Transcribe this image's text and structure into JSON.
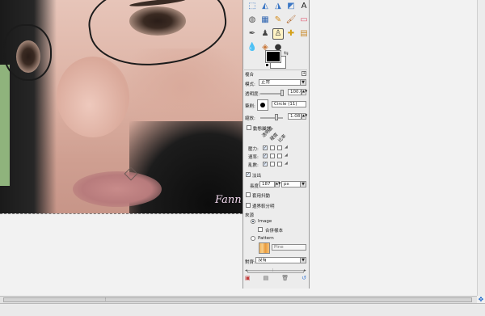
{
  "canvas": {
    "watermark_text": "Fann"
  },
  "toolbox": {
    "tools": [
      {
        "name": "rect-select-icon",
        "glyph": "⬚",
        "color": "#3a76c4"
      },
      {
        "name": "free-select-icon",
        "glyph": "◭",
        "color": "#3a76c4"
      },
      {
        "name": "fuzzy-select-icon",
        "glyph": "◮",
        "color": "#3a76c4"
      },
      {
        "name": "crop-icon",
        "glyph": "◩",
        "color": "#3a76c4"
      },
      {
        "name": "text-icon",
        "glyph": "A",
        "color": "#222222"
      },
      {
        "name": "bucket-fill-icon",
        "glyph": "◍",
        "color": "#555555"
      },
      {
        "name": "gradient-icon",
        "glyph": "▦",
        "color": "#2e64b0"
      },
      {
        "name": "pencil-icon",
        "glyph": "✎",
        "color": "#d48a17"
      },
      {
        "name": "paintbrush-icon",
        "glyph": "🖌",
        "color": "#b0662a"
      },
      {
        "name": "eraser-icon",
        "glyph": "▭",
        "color": "#e0556f"
      },
      {
        "name": "airbrush-icon",
        "glyph": "✒",
        "color": "#555555"
      },
      {
        "name": "ink-icon",
        "glyph": "♟",
        "color": "#444444"
      },
      {
        "name": "clone-icon",
        "glyph": "♙",
        "color": "#444444"
      },
      {
        "name": "heal-icon",
        "glyph": "✚",
        "color": "#d4a017"
      },
      {
        "name": "perspective-clone-icon",
        "glyph": "▤",
        "color": "#c88a2b"
      },
      {
        "name": "smudge-icon",
        "glyph": "💧",
        "color": "#3a7ac4"
      },
      {
        "name": "blur-icon",
        "glyph": "◈",
        "color": "#c9783a"
      },
      {
        "name": "dodge-burn-icon",
        "glyph": "●",
        "color": "#333333"
      }
    ],
    "mode_label": "模式:",
    "mode_value": "正常",
    "opacity_label": "透明度:",
    "opacity_value": "100.0",
    "brush_label": "筆刷:",
    "brush_value": "Circle (11)",
    "scale_label": "縮放:",
    "scale_value": "1.08",
    "dynamics_label": "動態屬性",
    "dyn_col_headers": [
      "透明度",
      "硬度",
      "比率"
    ],
    "dyn_rows": [
      "壓力:",
      "速率:",
      "亂數:"
    ],
    "fade_label": "淡出",
    "length_label": "長度:",
    "length_value": "187",
    "unit_value": "px",
    "jitter_label": "套用抖動",
    "hard_edge_label": "邊界較分明",
    "source_label": "來源",
    "source_image_label": "Image",
    "sample_merged_label": "合併樣本",
    "source_pattern_label": "Pattern",
    "pattern_name": "Pine",
    "alignment_label": "對齊:",
    "alignment_value": "沒有",
    "bottom_icons": [
      "save-options-icon",
      "restore-options-icon",
      "delete-options-icon",
      "reset-options-icon"
    ]
  },
  "colors": {
    "foreground": "#000000",
    "background": "#ffffff"
  }
}
